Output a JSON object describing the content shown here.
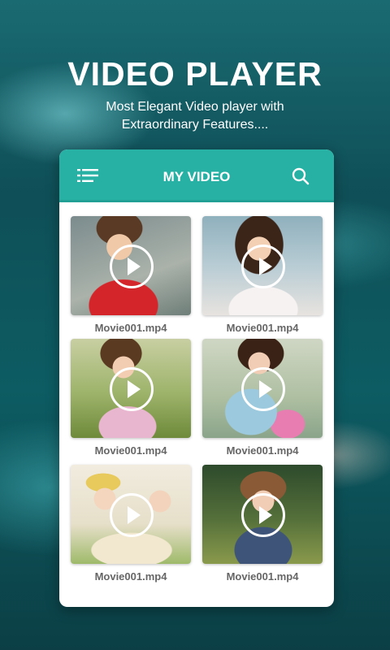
{
  "promo": {
    "headline": "VIDEO PLAYER",
    "subtitle_line1": "Most Elegant Video player with",
    "subtitle_line2": "Extraordinary Features...."
  },
  "appbar": {
    "title": "MY VIDEO",
    "menu_icon": "menu-list-icon",
    "search_icon": "search-icon",
    "accent_color": "#27b1a4"
  },
  "videos": [
    {
      "name": "Movie001.mp4"
    },
    {
      "name": "Movie001.mp4"
    },
    {
      "name": "Movie001.mp4"
    },
    {
      "name": "Movie001.mp4"
    },
    {
      "name": "Movie001.mp4"
    },
    {
      "name": "Movie001.mp4"
    }
  ]
}
